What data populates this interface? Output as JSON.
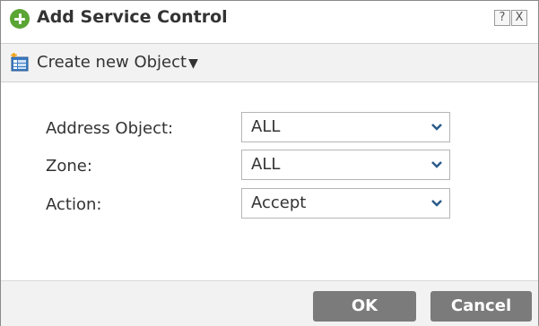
{
  "dialog": {
    "title": "Add Service Control",
    "help_label": "?",
    "close_label": "X"
  },
  "toolbar": {
    "create_label": "Create new Object",
    "create_caret": "▼"
  },
  "form": {
    "address_object": {
      "label": "Address Object:",
      "value": "ALL"
    },
    "zone": {
      "label": "Zone:",
      "value": "ALL"
    },
    "action": {
      "label": "Action:",
      "value": "Accept"
    }
  },
  "footer": {
    "ok_label": "OK",
    "cancel_label": "Cancel"
  },
  "colors": {
    "add_icon": "#5aa533",
    "button_bg": "#7b7b7b",
    "toolbar_bg": "#f2f2f2",
    "dropdown_arrow": "#2b5a8a"
  },
  "icons": {
    "title": "add-circle-icon",
    "create": "new-object-icon",
    "dropdown": "chevron-down-icon"
  }
}
